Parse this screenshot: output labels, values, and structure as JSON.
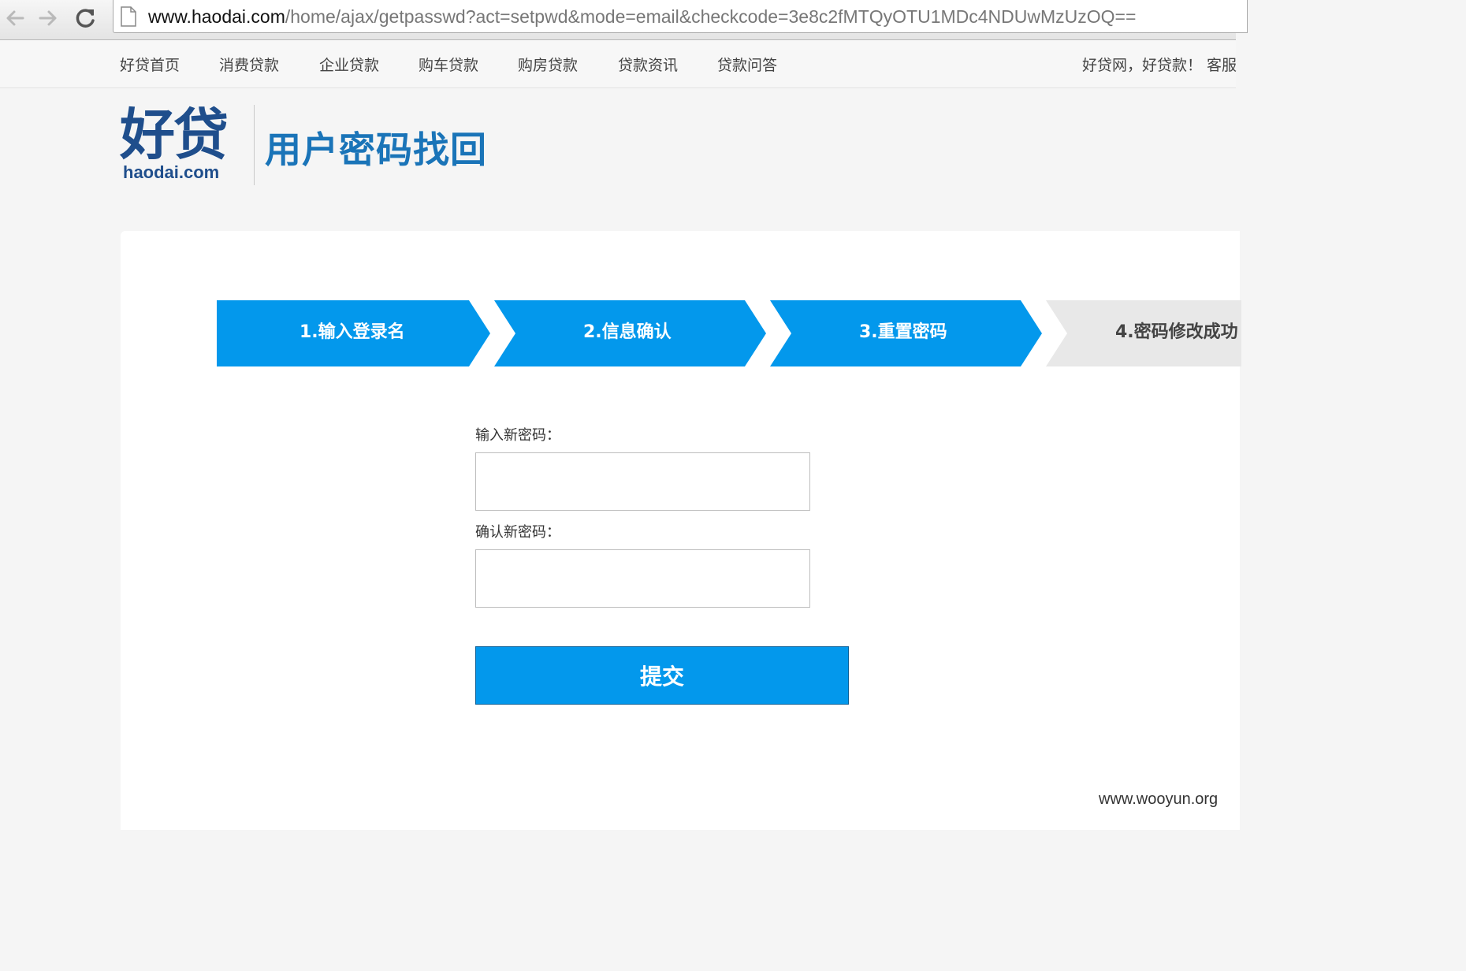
{
  "browser": {
    "url_host": "www.haodai.com",
    "url_path": "/home/ajax/getpasswd?act=setpwd&mode=email&checkcode=3e8c2fMTQyOTU1MDc4NDUwMzUzOQ=="
  },
  "topnav": {
    "items": [
      "好贷首页",
      "消费贷款",
      "企业贷款",
      "购车贷款",
      "购房贷款",
      "贷款资讯",
      "贷款问答"
    ],
    "slogan": "好贷网，好贷款！ 客服"
  },
  "header": {
    "logo_cn": "好贷",
    "logo_en": "haodai.com",
    "title": "用户密码找回"
  },
  "steps": [
    {
      "label": "1.输入登录名",
      "state": "done"
    },
    {
      "label": "2.信息确认",
      "state": "done"
    },
    {
      "label": "3.重置密码",
      "state": "current"
    },
    {
      "label": "4.密码修改成功",
      "state": "todo"
    }
  ],
  "form": {
    "new_password_label": "输入新密码：",
    "confirm_password_label": "确认新密码：",
    "submit_label": "提交"
  },
  "watermark": "www.wooyun.org",
  "colors": {
    "step_active": "#0398ec",
    "step_inactive": "#e8e8e8",
    "brand_dark": "#1f4e8c",
    "heading_blue": "#1a74b8"
  }
}
